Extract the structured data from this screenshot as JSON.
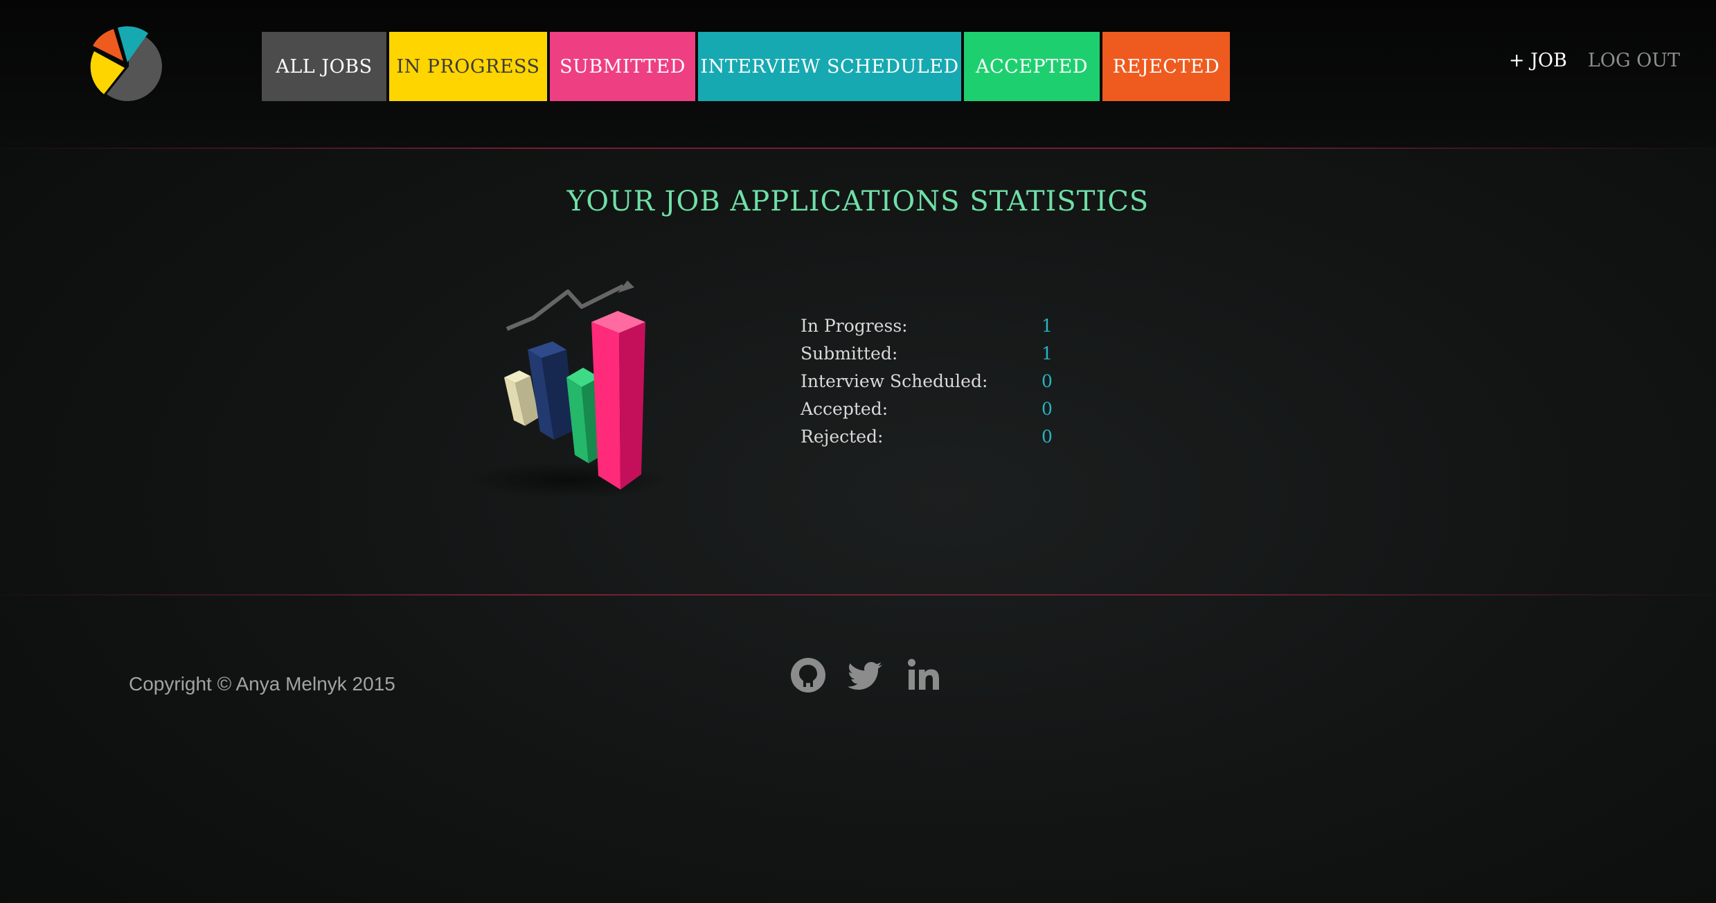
{
  "header": {
    "nav": [
      {
        "label": "ALL JOBS",
        "color": "#4c4c4c"
      },
      {
        "label": "IN PROGRESS",
        "color": "#ffd500"
      },
      {
        "label": "SUBMITTED",
        "color": "#ee3f82"
      },
      {
        "label": "INTERVIEW SCHEDULED",
        "color": "#17a9b1"
      },
      {
        "label": "ACCEPTED",
        "color": "#1ecf6f"
      },
      {
        "label": "REJECTED",
        "color": "#ef5b1f"
      }
    ],
    "add_job_label": "+ JOB",
    "logout_label": "LOG OUT",
    "logo_icon": "pie-chart-logo-icon"
  },
  "main": {
    "title": "YOUR JOB APPLICATIONS STATISTICS",
    "illustration_icon": "3d-bar-chart-icon",
    "stats": [
      {
        "label": "In Progress:",
        "value": "1"
      },
      {
        "label": "Submitted:",
        "value": "1"
      },
      {
        "label": "Interview Scheduled:",
        "value": "0"
      },
      {
        "label": "Accepted:",
        "value": "0"
      },
      {
        "label": "Rejected:",
        "value": "0"
      }
    ],
    "title_color": "#6fe0a6",
    "value_color": "#26b4c4"
  },
  "footer": {
    "copyright": "Copyright © Anya Melnyk 2015",
    "social": [
      "github-icon",
      "twitter-icon",
      "linkedin-icon"
    ]
  }
}
